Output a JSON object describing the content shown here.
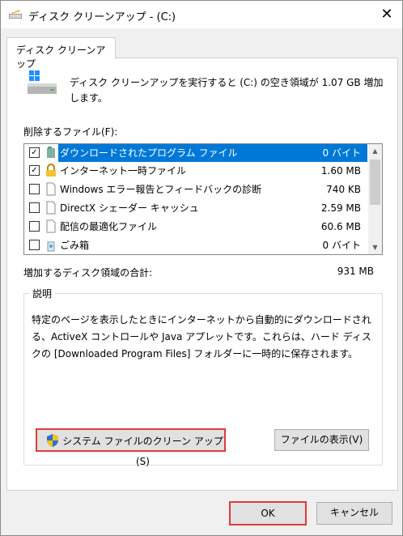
{
  "window": {
    "title": "ディスク クリーンアップ - (C:)",
    "close_glyph": "✕"
  },
  "tab": {
    "label": "ディスク クリーンアップ"
  },
  "summary": {
    "text": "ディスク クリーンアップを実行すると (C:) の空き領域が 1.07 GB 増加します。"
  },
  "files_label": "削除するファイル(F):",
  "files": [
    {
      "checked": true,
      "icon": "folder-icon",
      "name": "ダウンロードされたプログラム ファイル",
      "size": "0 バイト",
      "selected": true
    },
    {
      "checked": true,
      "icon": "lock-icon",
      "name": "インターネット一時ファイル",
      "size": "1.60 MB",
      "selected": false
    },
    {
      "checked": false,
      "icon": "file-icon",
      "name": "Windows エラー報告とフィードバックの診断",
      "size": "740 KB",
      "selected": false
    },
    {
      "checked": false,
      "icon": "file-icon",
      "name": "DirectX シェーダー キャッシュ",
      "size": "2.59 MB",
      "selected": false
    },
    {
      "checked": false,
      "icon": "file-icon",
      "name": "配信の最適化ファイル",
      "size": "60.6 MB",
      "selected": false
    },
    {
      "checked": false,
      "icon": "recycle-bin-icon",
      "name": "ごみ箱",
      "size": "0 バイト",
      "selected": false
    }
  ],
  "total": {
    "label": "増加するディスク領域の合計:",
    "value": "931 MB"
  },
  "description": {
    "title": "説明",
    "text": "特定のページを表示したときにインターネットから自動的にダウンロードされる、ActiveX コントロールや Java アプレットです。これらは、ハード ディスクの [Downloaded Program Files] フォルダーに一時的に保存されます。"
  },
  "buttons": {
    "cleanup_system": "システム ファイルのクリーン アップ(S)",
    "view_files": "ファイルの表示(V)",
    "ok": "OK",
    "cancel": "キャンセル"
  },
  "colors": {
    "selection": "#0078d7",
    "highlight_border": "#e03b3b"
  }
}
